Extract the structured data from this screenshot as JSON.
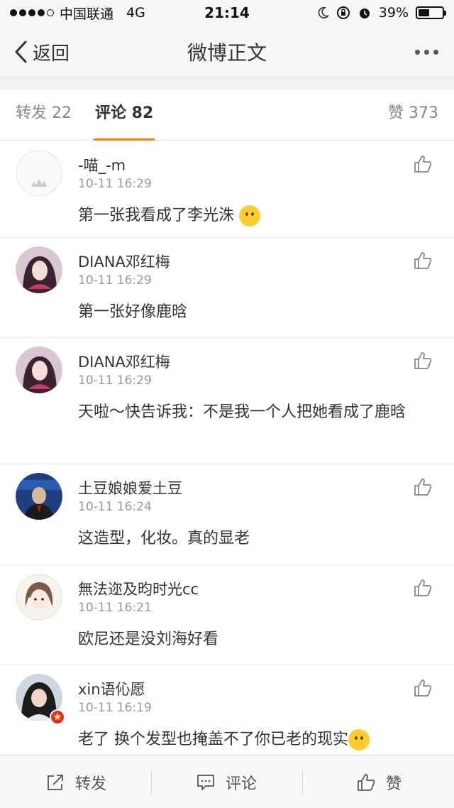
{
  "status_bar": {
    "carrier": "中国联通",
    "network": "4G",
    "time": "21:14",
    "battery": "39%"
  },
  "nav": {
    "back_label": "返回",
    "title": "微博正文"
  },
  "tabs": {
    "repost": "转发 22",
    "comment": "评论 82",
    "like": "赞 373"
  },
  "comments": [
    {
      "name": "-喵_-m",
      "time": "10-11 16:29",
      "text": "第一张我看成了李光洙"
    },
    {
      "name": "DIANA邓红梅",
      "time": "10-11 16:29",
      "text": "第一张好像鹿晗"
    },
    {
      "name": "DIANA邓红梅",
      "time": "10-11 16:29",
      "text": "天啦～快告诉我：不是我一个人把她看成了鹿晗"
    },
    {
      "name": "土豆娘娘爱土豆",
      "time": "10-11 16:24",
      "text": "这造型，化妆。真的显老"
    },
    {
      "name": "無法迩及昀时光cc",
      "time": "10-11 16:21",
      "text": "欧尼还是没刘海好看"
    },
    {
      "name": "xin语伈愿",
      "time": "10-11 16:19",
      "text": "老了 换个发型也掩盖不了你已老的现实"
    }
  ],
  "toolbar": {
    "repost": "转发",
    "comment": "评论",
    "like": "赞"
  },
  "colors": {
    "accent": "#ff8200",
    "bar_bg": "#f6f6f6"
  }
}
